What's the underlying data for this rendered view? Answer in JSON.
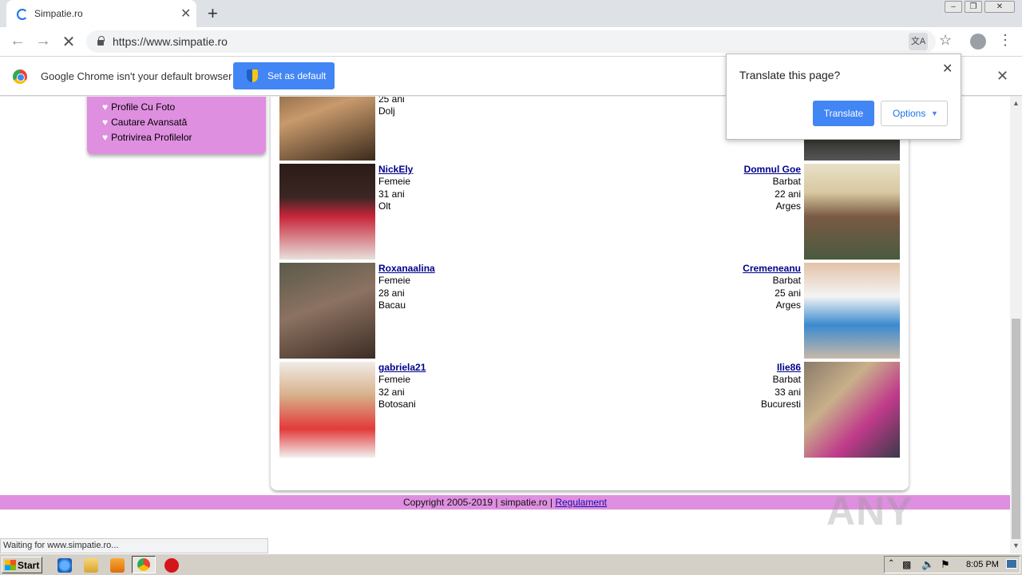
{
  "browser": {
    "tab_title": "Simpatie.ro",
    "tab_close": "✕",
    "new_tab": "+",
    "url": "https://www.simpatie.ro",
    "translate_icon_glyph": "文A",
    "infobar_text": "Google Chrome isn't your default browser",
    "set_default_label": "Set as default",
    "infobar_close": "✕",
    "status_text": "Waiting for www.simpatie.ro..."
  },
  "translate_popup": {
    "title": "Translate this page?",
    "close": "✕",
    "translate_label": "Translate",
    "options_label": "Options",
    "accent": "#4285f4"
  },
  "sidebar": {
    "items": [
      {
        "label": "Profile Cu Foto"
      },
      {
        "label": "Cautare Avansată"
      },
      {
        "label": "Potrivirea Profilelor"
      }
    ]
  },
  "profiles_top_partial": {
    "age": "25 ani",
    "county": "Dolj"
  },
  "profiles_left": [
    {
      "name": "NickEly",
      "gender": "Femeie",
      "age": "31 ani",
      "county": "Olt"
    },
    {
      "name": "Roxanaalina",
      "gender": "Femeie",
      "age": "28 ani",
      "county": "Bacau"
    },
    {
      "name": "gabriela21",
      "gender": "Femeie",
      "age": "32 ani",
      "county": "Botosani"
    }
  ],
  "profiles_right": [
    {
      "name": "Domnul Goe",
      "gender": "Barbat",
      "age": "22 ani",
      "county": "Arges"
    },
    {
      "name": "Cremeneanu",
      "gender": "Barbat",
      "age": "25 ani",
      "county": "Arges"
    },
    {
      "name": "Ilie86",
      "gender": "Barbat",
      "age": "33 ani",
      "county": "Bucuresti"
    }
  ],
  "footer": {
    "copyright": "Copyright 2005-2019 | simpatie.ro | ",
    "link": "Regulament"
  },
  "watermark": "ANY RUN",
  "taskbar": {
    "start_label": "Start",
    "clock": "8:05 PM"
  },
  "colors": {
    "brand_pink": "#df8fdf",
    "link": "#00008b"
  }
}
